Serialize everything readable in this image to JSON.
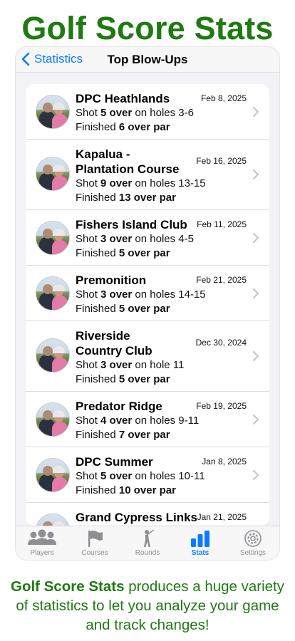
{
  "header": {
    "title": "Golf Score Stats"
  },
  "nav": {
    "back_label": "Statistics",
    "title": "Top Blow-Ups"
  },
  "rows": [
    {
      "course": "DPC Heathlands",
      "date": "Feb 8, 2025",
      "shot_prefix": "Shot ",
      "shot_over": "5 over",
      "shot_suffix": " on holes 3-6",
      "fin_prefix": "Finished ",
      "fin_over": "6 over par"
    },
    {
      "course": "Kapalua - Plantation Course",
      "date": "Feb 16, 2025",
      "shot_prefix": "Shot ",
      "shot_over": "9 over",
      "shot_suffix": " on holes 13-15",
      "fin_prefix": "Finished ",
      "fin_over": "13 over par"
    },
    {
      "course": "Fishers Island Club",
      "date": "Feb 11, 2025",
      "shot_prefix": "Shot ",
      "shot_over": "3 over",
      "shot_suffix": " on holes 4-5",
      "fin_prefix": "Finished ",
      "fin_over": "5 over par"
    },
    {
      "course": "Premonition",
      "date": "Feb 21, 2025",
      "shot_prefix": "Shot ",
      "shot_over": "3 over",
      "shot_suffix": " on holes 14-15",
      "fin_prefix": "Finished ",
      "fin_over": "5 over par"
    },
    {
      "course": "Riverside Country Club",
      "date": "Dec 30, 2024",
      "shot_prefix": "Shot ",
      "shot_over": "3 over",
      "shot_suffix": " on hole 11",
      "fin_prefix": "Finished ",
      "fin_over": "5 over par"
    },
    {
      "course": "Predator Ridge",
      "date": "Feb 19, 2025",
      "shot_prefix": "Shot ",
      "shot_over": "4 over",
      "shot_suffix": " on holes 9-11",
      "fin_prefix": "Finished ",
      "fin_over": "7 over par"
    },
    {
      "course": "DPC Summer",
      "date": "Jan 8, 2025",
      "shot_prefix": "Shot ",
      "shot_over": "5 over",
      "shot_suffix": " on holes 10-11",
      "fin_prefix": "Finished ",
      "fin_over": "10 over par"
    },
    {
      "course": "Grand Cypress Links",
      "date": "Jan 21, 2025",
      "shot_prefix": "",
      "shot_over": "",
      "shot_suffix": "",
      "fin_prefix": "",
      "fin_over": ""
    }
  ],
  "tabs": [
    {
      "label": "Players",
      "icon": "players-icon"
    },
    {
      "label": "Courses",
      "icon": "flag-icon"
    },
    {
      "label": "Rounds",
      "icon": "golfer-icon"
    },
    {
      "label": "Stats",
      "icon": "bar-chart-icon",
      "active": true
    },
    {
      "label": "Settings",
      "icon": "gear-icon"
    }
  ],
  "footer": {
    "bold": "Golf Score Stats",
    "text": " produces a huge variety of statistics to let you analyze your game and track changes!"
  },
  "colors": {
    "brand_green": "#1f7a12",
    "accent_blue": "#0a7aff",
    "inactive_gray": "#8e8e93"
  }
}
